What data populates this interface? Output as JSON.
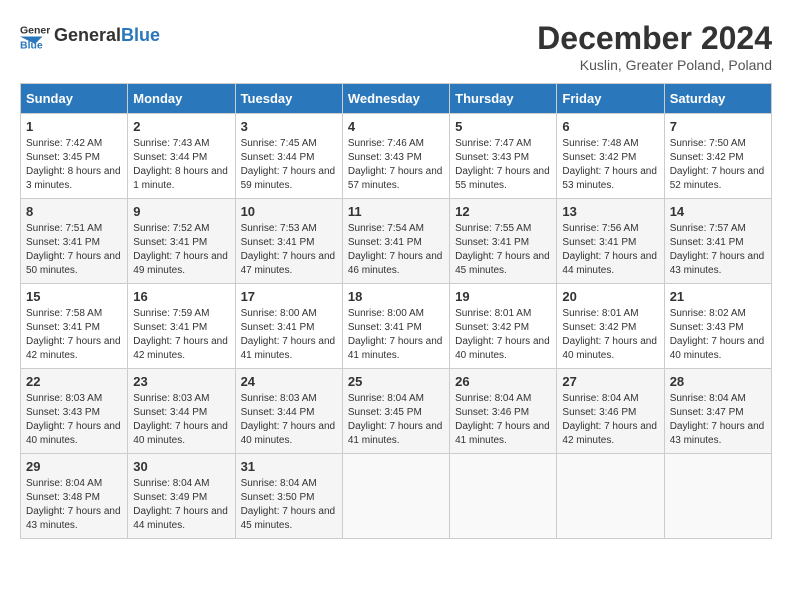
{
  "header": {
    "logo_general": "General",
    "logo_blue": "Blue",
    "title": "December 2024",
    "subtitle": "Kuslin, Greater Poland, Poland"
  },
  "calendar": {
    "days_of_week": [
      "Sunday",
      "Monday",
      "Tuesday",
      "Wednesday",
      "Thursday",
      "Friday",
      "Saturday"
    ],
    "weeks": [
      [
        {
          "day": "1",
          "sunrise": "Sunrise: 7:42 AM",
          "sunset": "Sunset: 3:45 PM",
          "daylight": "Daylight: 8 hours and 3 minutes."
        },
        {
          "day": "2",
          "sunrise": "Sunrise: 7:43 AM",
          "sunset": "Sunset: 3:44 PM",
          "daylight": "Daylight: 8 hours and 1 minute."
        },
        {
          "day": "3",
          "sunrise": "Sunrise: 7:45 AM",
          "sunset": "Sunset: 3:44 PM",
          "daylight": "Daylight: 7 hours and 59 minutes."
        },
        {
          "day": "4",
          "sunrise": "Sunrise: 7:46 AM",
          "sunset": "Sunset: 3:43 PM",
          "daylight": "Daylight: 7 hours and 57 minutes."
        },
        {
          "day": "5",
          "sunrise": "Sunrise: 7:47 AM",
          "sunset": "Sunset: 3:43 PM",
          "daylight": "Daylight: 7 hours and 55 minutes."
        },
        {
          "day": "6",
          "sunrise": "Sunrise: 7:48 AM",
          "sunset": "Sunset: 3:42 PM",
          "daylight": "Daylight: 7 hours and 53 minutes."
        },
        {
          "day": "7",
          "sunrise": "Sunrise: 7:50 AM",
          "sunset": "Sunset: 3:42 PM",
          "daylight": "Daylight: 7 hours and 52 minutes."
        }
      ],
      [
        {
          "day": "8",
          "sunrise": "Sunrise: 7:51 AM",
          "sunset": "Sunset: 3:41 PM",
          "daylight": "Daylight: 7 hours and 50 minutes."
        },
        {
          "day": "9",
          "sunrise": "Sunrise: 7:52 AM",
          "sunset": "Sunset: 3:41 PM",
          "daylight": "Daylight: 7 hours and 49 minutes."
        },
        {
          "day": "10",
          "sunrise": "Sunrise: 7:53 AM",
          "sunset": "Sunset: 3:41 PM",
          "daylight": "Daylight: 7 hours and 47 minutes."
        },
        {
          "day": "11",
          "sunrise": "Sunrise: 7:54 AM",
          "sunset": "Sunset: 3:41 PM",
          "daylight": "Daylight: 7 hours and 46 minutes."
        },
        {
          "day": "12",
          "sunrise": "Sunrise: 7:55 AM",
          "sunset": "Sunset: 3:41 PM",
          "daylight": "Daylight: 7 hours and 45 minutes."
        },
        {
          "day": "13",
          "sunrise": "Sunrise: 7:56 AM",
          "sunset": "Sunset: 3:41 PM",
          "daylight": "Daylight: 7 hours and 44 minutes."
        },
        {
          "day": "14",
          "sunrise": "Sunrise: 7:57 AM",
          "sunset": "Sunset: 3:41 PM",
          "daylight": "Daylight: 7 hours and 43 minutes."
        }
      ],
      [
        {
          "day": "15",
          "sunrise": "Sunrise: 7:58 AM",
          "sunset": "Sunset: 3:41 PM",
          "daylight": "Daylight: 7 hours and 42 minutes."
        },
        {
          "day": "16",
          "sunrise": "Sunrise: 7:59 AM",
          "sunset": "Sunset: 3:41 PM",
          "daylight": "Daylight: 7 hours and 42 minutes."
        },
        {
          "day": "17",
          "sunrise": "Sunrise: 8:00 AM",
          "sunset": "Sunset: 3:41 PM",
          "daylight": "Daylight: 7 hours and 41 minutes."
        },
        {
          "day": "18",
          "sunrise": "Sunrise: 8:00 AM",
          "sunset": "Sunset: 3:41 PM",
          "daylight": "Daylight: 7 hours and 41 minutes."
        },
        {
          "day": "19",
          "sunrise": "Sunrise: 8:01 AM",
          "sunset": "Sunset: 3:42 PM",
          "daylight": "Daylight: 7 hours and 40 minutes."
        },
        {
          "day": "20",
          "sunrise": "Sunrise: 8:01 AM",
          "sunset": "Sunset: 3:42 PM",
          "daylight": "Daylight: 7 hours and 40 minutes."
        },
        {
          "day": "21",
          "sunrise": "Sunrise: 8:02 AM",
          "sunset": "Sunset: 3:43 PM",
          "daylight": "Daylight: 7 hours and 40 minutes."
        }
      ],
      [
        {
          "day": "22",
          "sunrise": "Sunrise: 8:03 AM",
          "sunset": "Sunset: 3:43 PM",
          "daylight": "Daylight: 7 hours and 40 minutes."
        },
        {
          "day": "23",
          "sunrise": "Sunrise: 8:03 AM",
          "sunset": "Sunset: 3:44 PM",
          "daylight": "Daylight: 7 hours and 40 minutes."
        },
        {
          "day": "24",
          "sunrise": "Sunrise: 8:03 AM",
          "sunset": "Sunset: 3:44 PM",
          "daylight": "Daylight: 7 hours and 40 minutes."
        },
        {
          "day": "25",
          "sunrise": "Sunrise: 8:04 AM",
          "sunset": "Sunset: 3:45 PM",
          "daylight": "Daylight: 7 hours and 41 minutes."
        },
        {
          "day": "26",
          "sunrise": "Sunrise: 8:04 AM",
          "sunset": "Sunset: 3:46 PM",
          "daylight": "Daylight: 7 hours and 41 minutes."
        },
        {
          "day": "27",
          "sunrise": "Sunrise: 8:04 AM",
          "sunset": "Sunset: 3:46 PM",
          "daylight": "Daylight: 7 hours and 42 minutes."
        },
        {
          "day": "28",
          "sunrise": "Sunrise: 8:04 AM",
          "sunset": "Sunset: 3:47 PM",
          "daylight": "Daylight: 7 hours and 43 minutes."
        }
      ],
      [
        {
          "day": "29",
          "sunrise": "Sunrise: 8:04 AM",
          "sunset": "Sunset: 3:48 PM",
          "daylight": "Daylight: 7 hours and 43 minutes."
        },
        {
          "day": "30",
          "sunrise": "Sunrise: 8:04 AM",
          "sunset": "Sunset: 3:49 PM",
          "daylight": "Daylight: 7 hours and 44 minutes."
        },
        {
          "day": "31",
          "sunrise": "Sunrise: 8:04 AM",
          "sunset": "Sunset: 3:50 PM",
          "daylight": "Daylight: 7 hours and 45 minutes."
        },
        {
          "day": "",
          "sunrise": "",
          "sunset": "",
          "daylight": ""
        },
        {
          "day": "",
          "sunrise": "",
          "sunset": "",
          "daylight": ""
        },
        {
          "day": "",
          "sunrise": "",
          "sunset": "",
          "daylight": ""
        },
        {
          "day": "",
          "sunrise": "",
          "sunset": "",
          "daylight": ""
        }
      ]
    ]
  }
}
